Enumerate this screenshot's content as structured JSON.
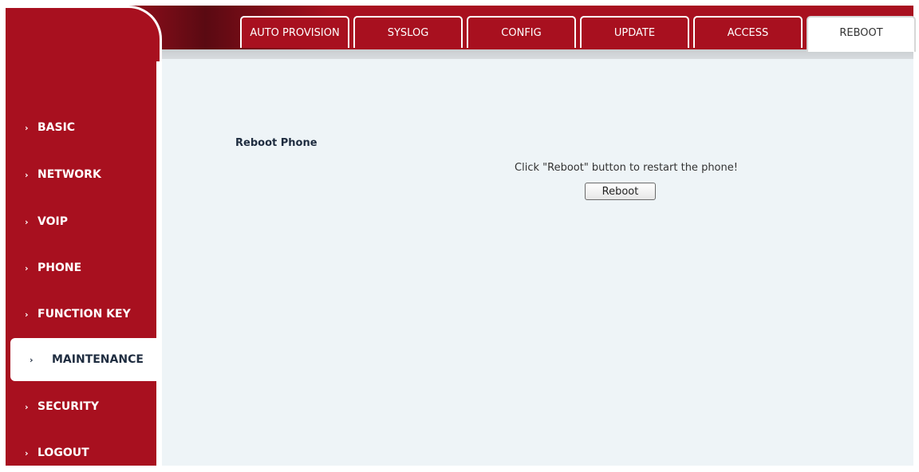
{
  "tabs": [
    {
      "label": "AUTO PROVISION"
    },
    {
      "label": "SYSLOG"
    },
    {
      "label": "CONFIG"
    },
    {
      "label": "UPDATE"
    },
    {
      "label": "ACCESS"
    },
    {
      "label": "REBOOT",
      "active": true
    }
  ],
  "sidebar": {
    "items": [
      {
        "label": "BASIC"
      },
      {
        "label": "NETWORK"
      },
      {
        "label": "VOIP"
      },
      {
        "label": "PHONE"
      },
      {
        "label": "FUNCTION KEY"
      },
      {
        "label": "MAINTENANCE",
        "active": true
      },
      {
        "label": "SECURITY"
      },
      {
        "label": "LOGOUT"
      }
    ]
  },
  "main": {
    "section_title": "Reboot Phone",
    "hint": "Click \"Reboot\" button to restart the phone!",
    "reboot_button": "Reboot"
  },
  "colors": {
    "brand_red": "#a8101f",
    "content_bg": "#eef4f7"
  }
}
